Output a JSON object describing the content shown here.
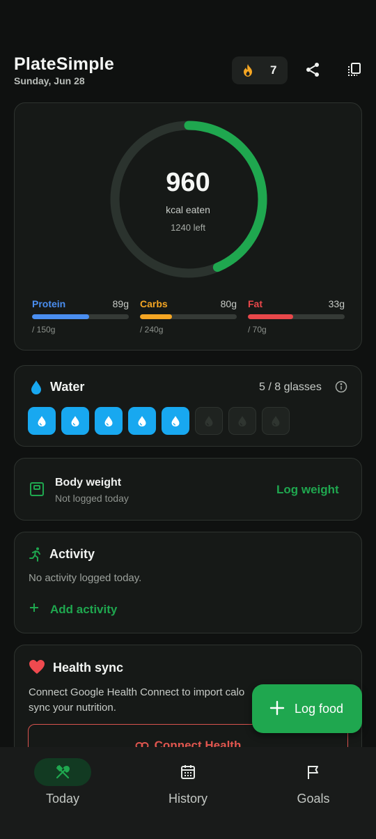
{
  "header": {
    "title": "PlateSimple",
    "date": "Sunday, Jun 28",
    "streak_count": "7",
    "streak_icon": "flame-icon",
    "share_icon": "share-icon",
    "copy_icon": "copy-icon"
  },
  "summary": {
    "kcal_eaten": "960",
    "kcal_label": "kcal eaten",
    "kcal_left": "1240 left",
    "progress": 0.436,
    "ring_color": "#1fa74f",
    "macros": [
      {
        "name": "Protein",
        "amount": "89g",
        "goal": "/ 150g",
        "progress": 0.593,
        "color": "#4a8ef0"
      },
      {
        "name": "Carbs",
        "amount": "80g",
        "goal": "/ 240g",
        "progress": 0.333,
        "color": "#f5a623"
      },
      {
        "name": "Fat",
        "amount": "33g",
        "goal": "/ 70g",
        "progress": 0.471,
        "color": "#e8474a"
      }
    ]
  },
  "water": {
    "title": "Water",
    "count": "5 / 8 glasses",
    "filled": 5,
    "total": 8,
    "color": "#18a8f0"
  },
  "weight": {
    "title": "Body weight",
    "subtitle": "Not logged today",
    "action": "Log weight"
  },
  "activity": {
    "title": "Activity",
    "empty_text": "No activity logged today.",
    "add_label": "Add activity"
  },
  "health": {
    "title": "Health sync",
    "desc_line1": "Connect Google Health Connect to import calo",
    "desc_line2": "sync your nutrition.",
    "connect_label": "Connect Health"
  },
  "fab": {
    "label": "Log food"
  },
  "nav": {
    "today": "Today",
    "history": "History",
    "goals": "Goals",
    "active": "today"
  },
  "colors": {
    "accent": "#1fa74f",
    "background": "#0f1110",
    "card": "#161917"
  }
}
